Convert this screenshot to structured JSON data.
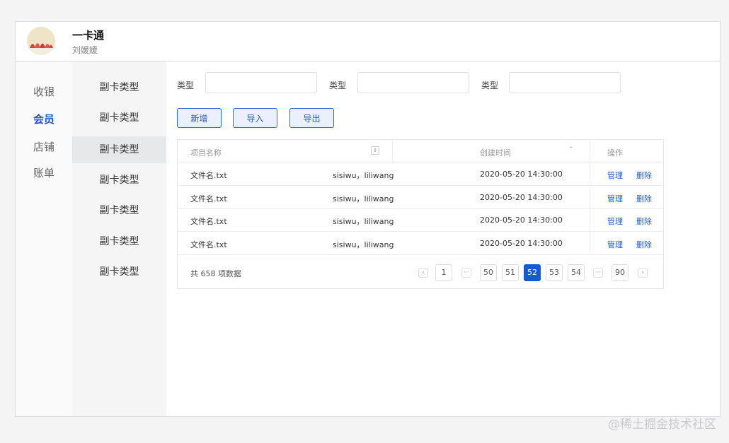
{
  "header": {
    "title": "一卡通",
    "username": "刘媛媛"
  },
  "nav": {
    "items": [
      "收银",
      "会员",
      "店铺",
      "账单"
    ],
    "active_index": 1
  },
  "subnav": {
    "items": [
      "副卡类型",
      "副卡类型",
      "副卡类型",
      "副卡类型",
      "副卡类型",
      "副卡类型",
      "副卡类型"
    ],
    "active_index": 2
  },
  "filters": [
    {
      "label": "类型",
      "value": ""
    },
    {
      "label": "类型",
      "value": ""
    },
    {
      "label": "类型",
      "value": ""
    }
  ],
  "toolbar": {
    "add_label": "新增",
    "import_label": "导入",
    "export_label": "导出"
  },
  "table": {
    "columns": {
      "name": "项目名称",
      "created": "创建时间",
      "actions": "操作"
    },
    "rows": [
      {
        "name": "文件名.txt",
        "people": "sisiwu，liliwang",
        "created": "2020-05-20 14:30:00",
        "manage": "管理",
        "delete": "删除"
      },
      {
        "name": "文件名.txt",
        "people": "sisiwu，liliwang",
        "created": "2020-05-20 14:30:00",
        "manage": "管理",
        "delete": "删除"
      },
      {
        "name": "文件名.txt",
        "people": "sisiwu，liliwang",
        "created": "2020-05-20 14:30:00",
        "manage": "管理",
        "delete": "删除"
      },
      {
        "name": "文件名.txt",
        "people": "sisiwu，liliwang",
        "created": "2020-05-20 14:30:00",
        "manage": "管理",
        "delete": "删除"
      }
    ],
    "total_text": "共 658 项数据"
  },
  "pagination": {
    "prev": "‹",
    "next": "›",
    "ellipsis": "···",
    "pages": [
      "1",
      "50",
      "51",
      "52",
      "53",
      "54",
      "90"
    ],
    "current": "52"
  },
  "watermark": "@稀土掘金技术社区",
  "colors": {
    "accent": "#1459d6",
    "link": "#1a5ed0"
  }
}
